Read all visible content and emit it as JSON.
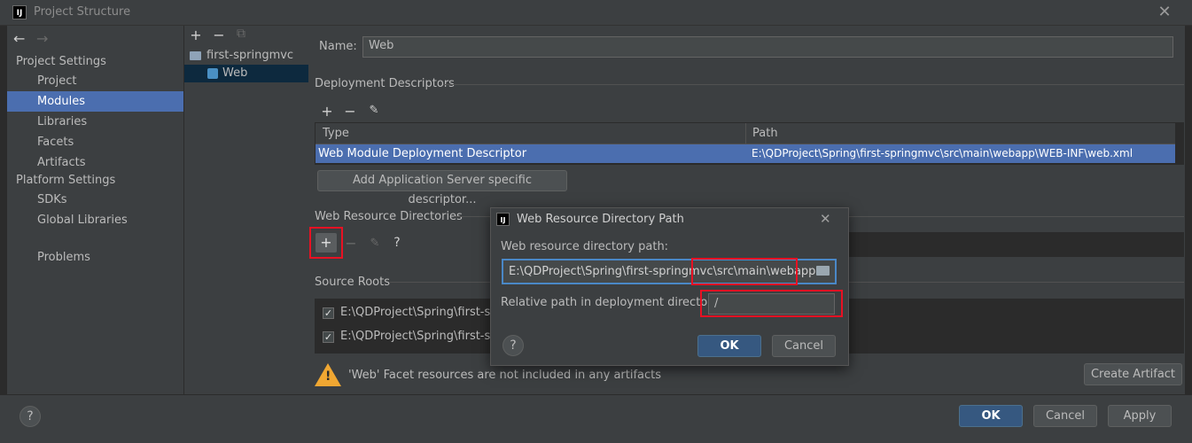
{
  "window": {
    "logo": "IJ",
    "title": "Project Structure",
    "close_glyph": "✕"
  },
  "nav": {
    "back_glyph": "←",
    "forward_glyph": "→",
    "project_settings_header": "Project Settings",
    "project_settings": [
      "Project",
      "Modules",
      "Libraries",
      "Facets",
      "Artifacts"
    ],
    "platform_settings_header": "Platform Settings",
    "platform_settings": [
      "SDKs",
      "Global Libraries"
    ],
    "problems": "Problems",
    "selected": "Modules"
  },
  "modules_tree": {
    "add_glyph": "+",
    "remove_glyph": "−",
    "copy_glyph": "⧉",
    "items": [
      {
        "label": "first-springmvc",
        "icon": "folder-module-icon"
      },
      {
        "label": "Web",
        "icon": "web-facet-icon"
      }
    ]
  },
  "facet": {
    "name_label": "Name:",
    "name_value": "Web",
    "deployment_descriptors_title": "Deployment Descriptors",
    "dd_table": {
      "columns": [
        "Type",
        "Path"
      ],
      "rows": [
        {
          "type": "Web Module Deployment Descriptor",
          "path": "E:\\QDProject\\Spring\\first-springmvc\\src\\main\\webapp\\WEB-INF\\web.xml"
        }
      ]
    },
    "add_server_descriptor_button": "Add Application Server specific descriptor...",
    "web_resource_dirs_title": "Web Resource Directories",
    "source_roots_title": "Source Roots",
    "source_roots": [
      {
        "checked": true,
        "path": "E:\\QDProject\\Spring\\first-spr"
      },
      {
        "checked": true,
        "path": "E:\\QDProject\\Spring\\first-spr"
      }
    ],
    "warning_text": "'Web' Facet resources are not included in any artifacts",
    "create_artifact_button": "Create Artifact"
  },
  "dialog": {
    "title": "Web Resource Directory Path",
    "close_glyph": "✕",
    "path_label": "Web resource directory path:",
    "path_value_prefix": "E:\\QDProject\\Spring\\first-springmvc",
    "path_value_suffix": "\\src\\main\\webapp",
    "relative_label": "Relative path in deployment directory:",
    "relative_value": "/",
    "ok_button": "OK",
    "cancel_button": "Cancel",
    "help_glyph": "?"
  },
  "footer": {
    "help_glyph": "?",
    "ok_button": "OK",
    "cancel_button": "Cancel",
    "apply_button": "Apply"
  },
  "colors": {
    "accent_selection": "#4b6eaf",
    "primary_button": "#365880",
    "highlight_red": "#e81123",
    "warning": "#f0a732"
  }
}
